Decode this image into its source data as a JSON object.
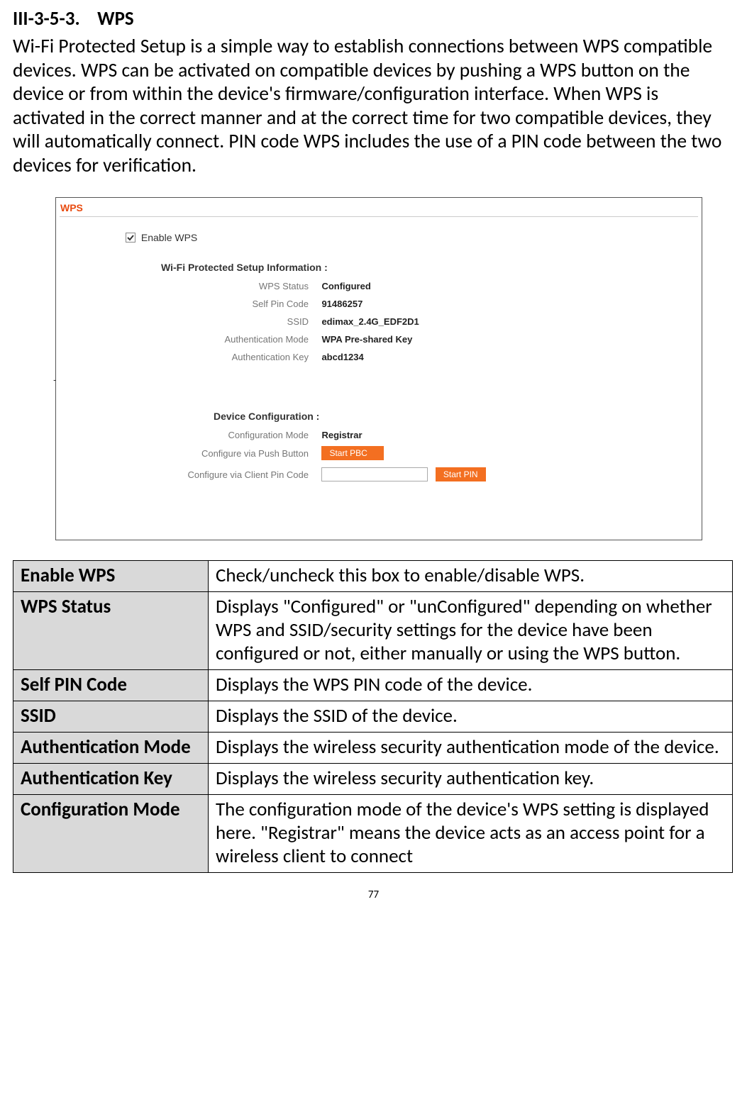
{
  "heading": {
    "num": "III-3-5-3.",
    "title": "WPS"
  },
  "intro": "Wi-Fi Protected Setup is a simple way to establish connections between WPS compatible devices. WPS can be activated on compatible devices by pushing a WPS button on the device or from within the device's firmware/configuration interface. When WPS is activated in the correct manner and at the correct time for two compatible devices, they will automatically connect. PIN code WPS includes the use of a PIN code between the two devices for verification.",
  "screenshot": {
    "header": "WPS",
    "enable_label": "Enable   WPS",
    "info_title": "Wi-Fi Protected Setup Information  :",
    "info_rows": [
      {
        "label": "WPS Status",
        "value": "Configured"
      },
      {
        "label": "Self Pin Code",
        "value": "91486257"
      },
      {
        "label": "SSID",
        "value": "edimax_2.4G_EDF2D1"
      },
      {
        "label": "Authentication Mode",
        "value": "WPA Pre-shared Key"
      },
      {
        "label": "Authentication Key",
        "value": "abcd1234"
      }
    ],
    "config_title": "Device Configuration  :",
    "config_mode": {
      "label": "Configuration Mode",
      "value": "Registrar"
    },
    "pbc": {
      "label": "Configure via Push Button",
      "button": "Start PBC"
    },
    "pin": {
      "label": "Configure via Client Pin Code",
      "button": "Start PIN"
    }
  },
  "table": [
    {
      "term": "Enable WPS",
      "desc": "Check/uncheck this box to enable/disable WPS."
    },
    {
      "term": "WPS Status",
      "desc": "Displays \"Configured\" or \"unConfigured\" depending on whether WPS and SSID/security settings for the device have been configured or not, either manually or using the WPS button."
    },
    {
      "term": "Self PIN Code",
      "desc": "Displays the WPS PIN code of the device."
    },
    {
      "term": "SSID",
      "desc": "Displays the SSID of the device."
    },
    {
      "term": "Authentication Mode",
      "desc": "Displays the wireless security authentication mode of the device."
    },
    {
      "term": "Authentication Key",
      "desc": "Displays the wireless security authentication key."
    },
    {
      "term": "Configuration Mode",
      "desc": "The configuration mode of the device's WPS setting is displayed here. \"Registrar\" means the device acts as an access point for a wireless client to connect"
    }
  ],
  "page_number": "77"
}
